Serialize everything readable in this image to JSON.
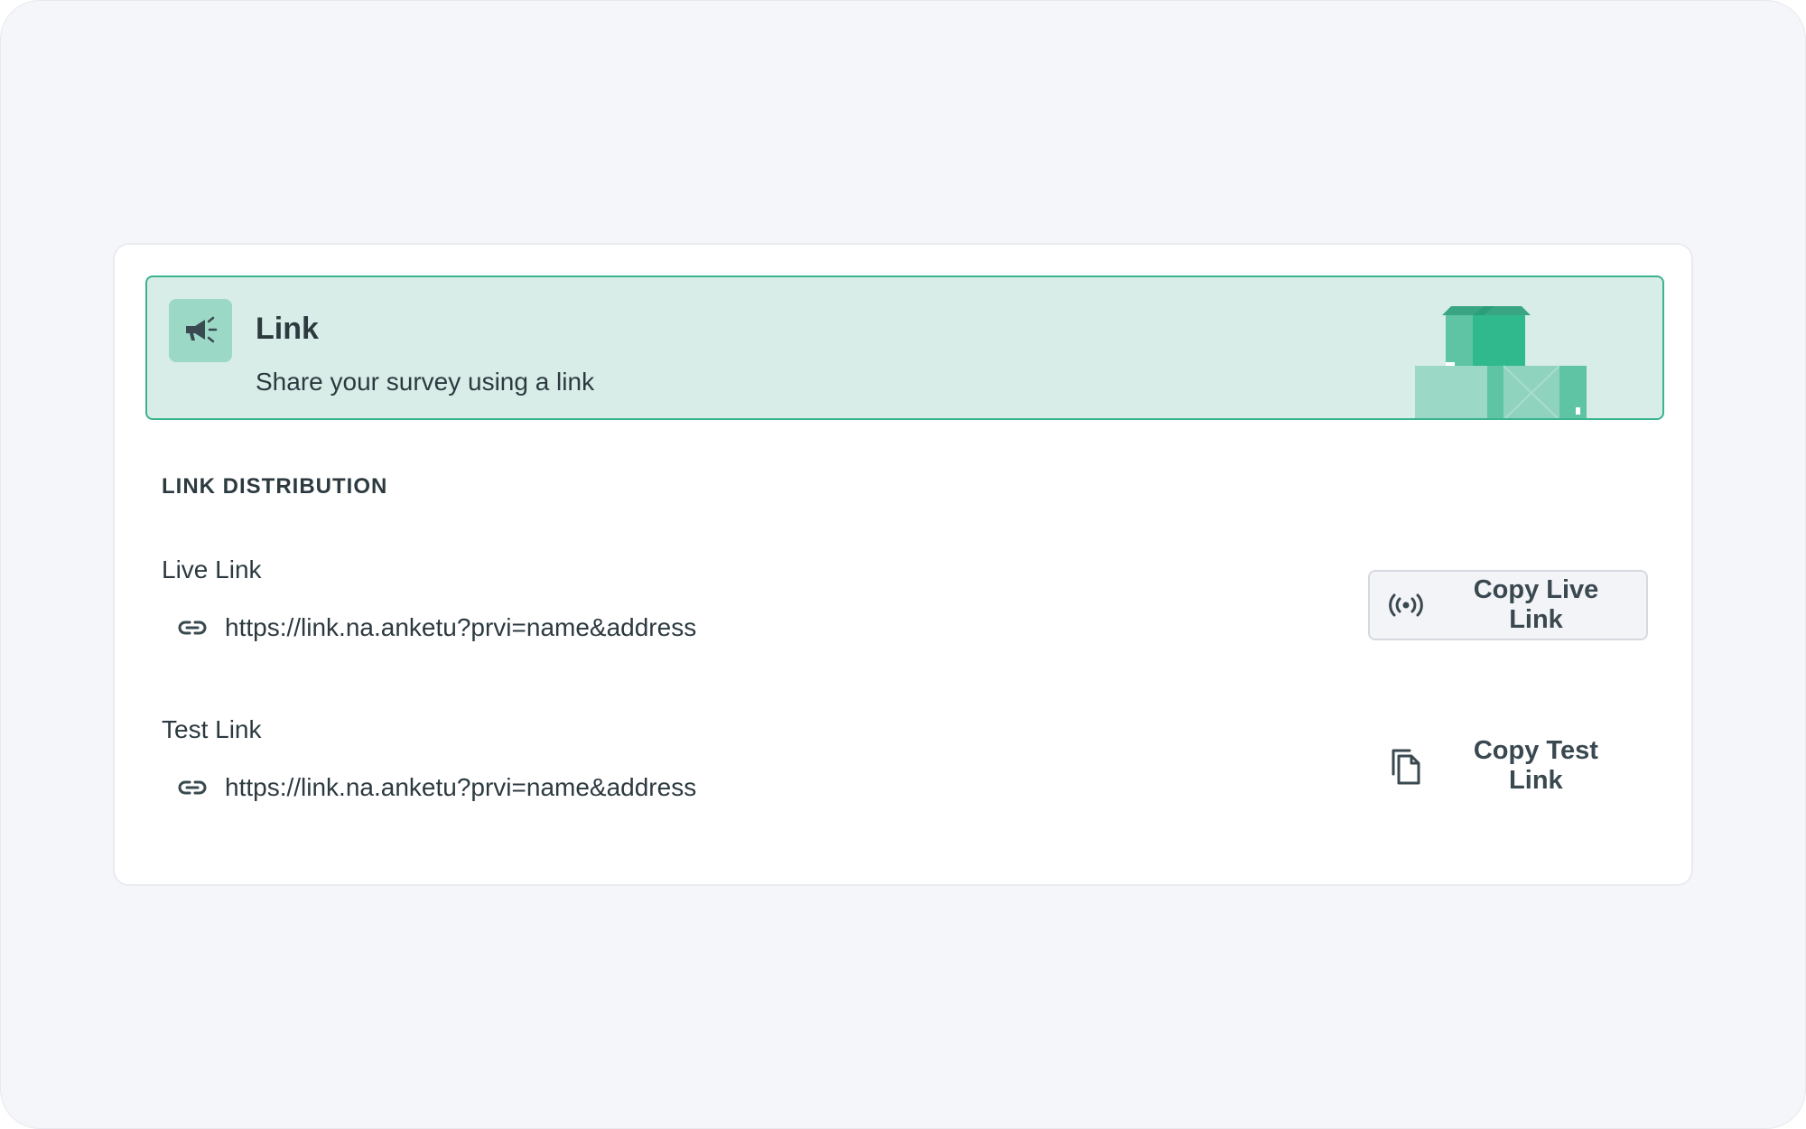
{
  "banner": {
    "title": "Link",
    "subtitle": "Share your survey using a link",
    "icon": "megaphone-icon"
  },
  "distribution": {
    "heading": "LINK DISTRIBUTION",
    "live": {
      "label": "Live Link",
      "url": "https://link.na.anketu?prvi=name&address",
      "button_label": "Copy Live Link",
      "button_icon": "broadcast-icon"
    },
    "test": {
      "label": "Test Link",
      "url": "https://link.na.anketu?prvi=name&address",
      "button_label": "Copy Test Link",
      "button_icon": "copy-icon"
    }
  },
  "colors": {
    "page_background": "#f5f6f9",
    "card_background": "#ffffff",
    "banner_background": "#d8ede7",
    "banner_border": "#3bb38e",
    "text": "#2c3a40"
  }
}
